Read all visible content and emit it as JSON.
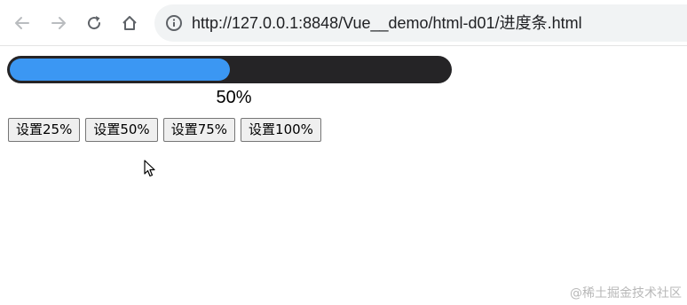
{
  "browser": {
    "url": "http://127.0.0.1:8848/Vue__demo/html-d01/进度条.html",
    "icons": [
      "back-arrow-icon",
      "forward-arrow-icon",
      "reload-icon",
      "home-icon",
      "info-icon"
    ]
  },
  "progress": {
    "value": 0.5,
    "label": "50%",
    "track_color": "#252426",
    "fill_color": "#3b97f3"
  },
  "buttons": [
    {
      "label": "设置25%"
    },
    {
      "label": "设置50%"
    },
    {
      "label": "设置75%"
    },
    {
      "label": "设置100%"
    }
  ],
  "watermark": "@稀土掘金技术社区"
}
